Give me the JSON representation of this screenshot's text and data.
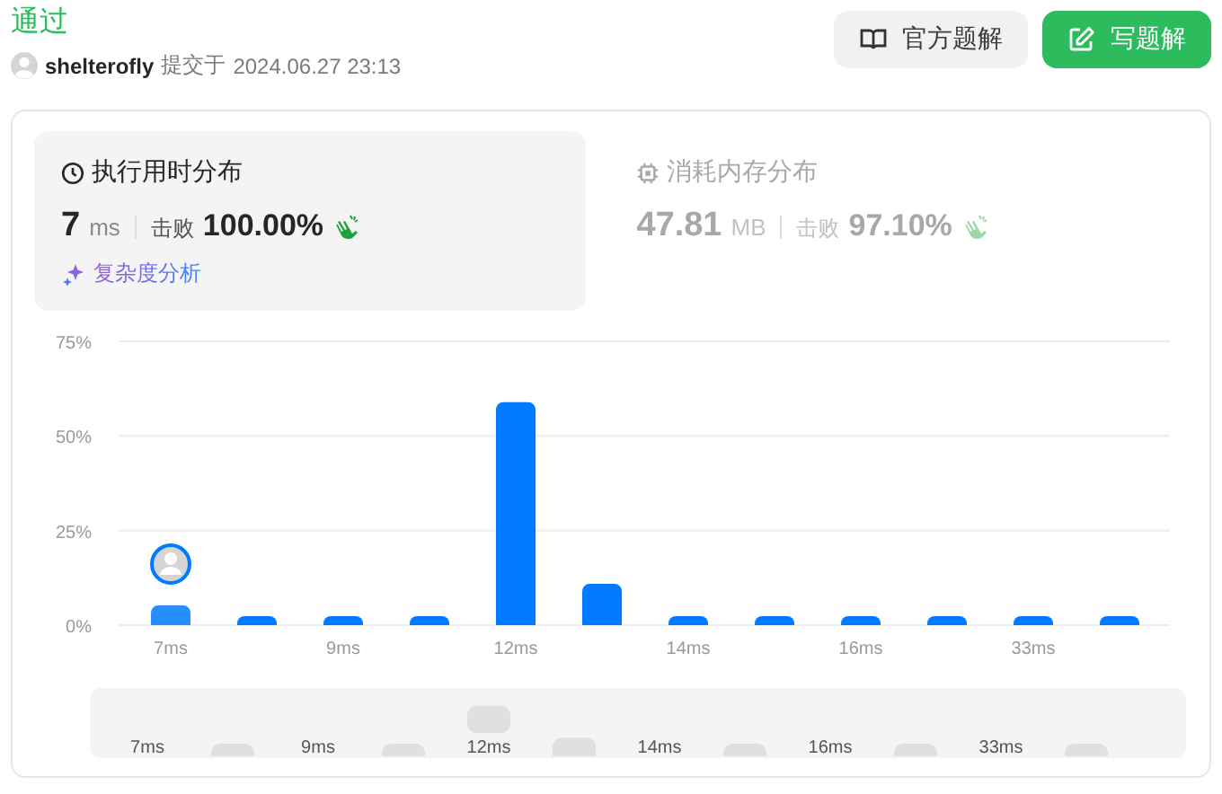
{
  "status": "通过",
  "author": {
    "name": "shelterofly",
    "action": "提交于",
    "time": "2024.06.27 23:13"
  },
  "buttons": [
    {
      "label": "官方题解",
      "kind": "secondary"
    },
    {
      "label": "写题解",
      "kind": "primary"
    }
  ],
  "stats": [
    {
      "kind": "runtime",
      "title": "执行用时分布",
      "value": "7",
      "unit": "ms",
      "beat_label": "击败",
      "beat": "100.00%",
      "selected": true,
      "link": "复杂度分析"
    },
    {
      "kind": "memory",
      "title": "消耗内存分布",
      "value": "47.81",
      "unit": "MB",
      "beat_label": "击败",
      "beat": "97.10%",
      "selected": false
    }
  ],
  "chart": {
    "chart_data": {
      "type": "bar",
      "categories": [
        "7ms",
        null,
        "9ms",
        null,
        "12ms",
        null,
        "14ms",
        null,
        "16ms",
        null,
        "33ms",
        null
      ],
      "series": [
        {
          "color": "#007aff",
          "values": [
            5.2,
            2.4,
            2.4,
            2.4,
            58.9,
            10.9,
            2.4,
            2.4,
            2.4,
            2.4,
            2.4,
            2.4
          ]
        }
      ],
      "ylim": [
        0,
        75
      ],
      "yticks": [
        {
          "value": 0,
          "label": "0%"
        },
        {
          "value": 25,
          "label": "25%"
        },
        {
          "value": 50,
          "label": "50%"
        },
        {
          "value": 75,
          "label": "75%"
        }
      ]
    },
    "user_marker": true
  },
  "navigator": {
    "labels": [
      "7ms",
      "9ms",
      "12ms",
      "14ms",
      "16ms",
      "33ms"
    ]
  }
}
